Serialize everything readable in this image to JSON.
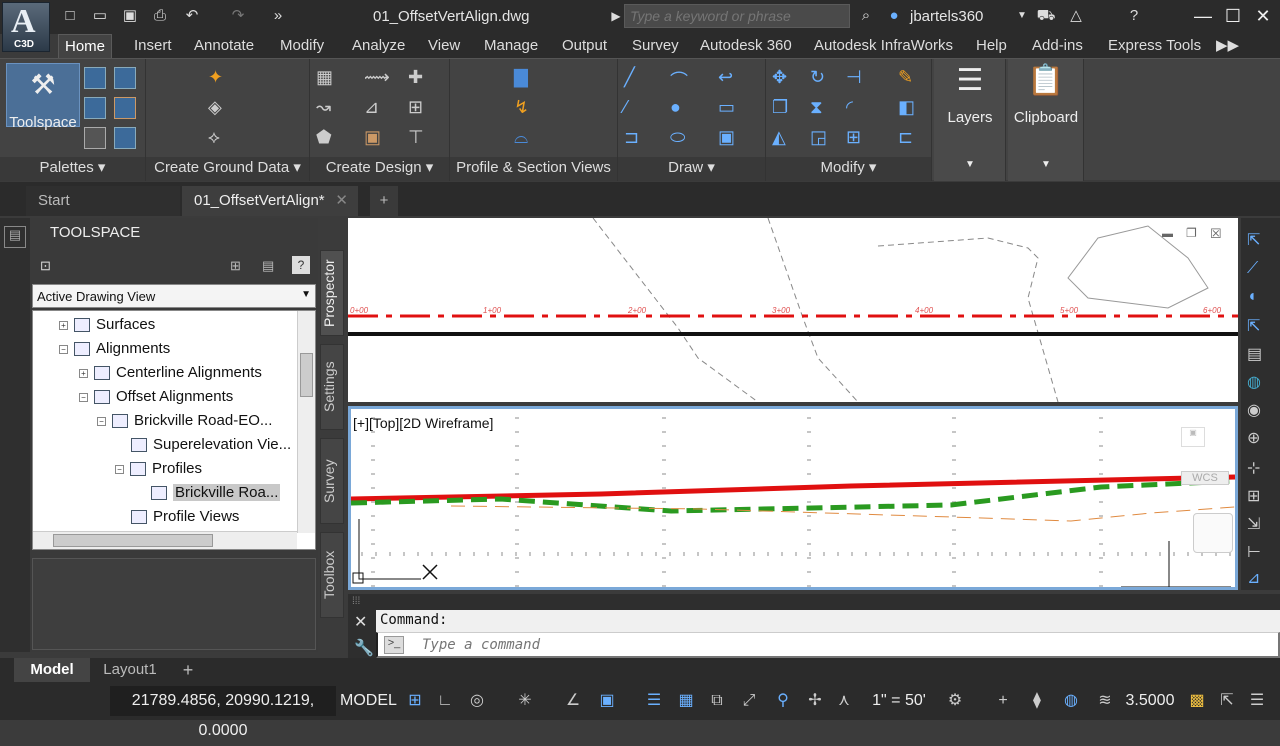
{
  "app": {
    "logo_text": "A",
    "logo_sub": "C3D",
    "doc_title": "01_OffsetVertAlign.dwg"
  },
  "search": {
    "placeholder": "Type a keyword or phrase"
  },
  "user": {
    "name": "jbartels360"
  },
  "menu_tabs": [
    "Home",
    "Insert",
    "Annotate",
    "Modify",
    "Analyze",
    "View",
    "Manage",
    "Output",
    "Survey",
    "Autodesk 360",
    "Autodesk InfraWorks",
    "Help",
    "Add-ins",
    "Express Tools"
  ],
  "ribbon": {
    "toolspace_label": "Toolspace",
    "layers_label": "Layers",
    "clipboard_label": "Clipboard",
    "panels": [
      "Palettes",
      "Create Ground Data",
      "Create Design",
      "Profile & Section Views",
      "Draw",
      "Modify"
    ]
  },
  "doc_tabs": {
    "start": "Start",
    "active": "01_OffsetVertAlign*"
  },
  "toolspace": {
    "title": "TOOLSPACE",
    "view_select": "Active Drawing View",
    "tree": [
      "Surfaces",
      "Alignments",
      "Centerline Alignments",
      "Offset Alignments",
      "Brickville Road-EO...",
      "Superelevation Vie...",
      "Profiles",
      "Brickville Roa...",
      "Profile Views"
    ],
    "side_tabs": [
      "Prospector",
      "Settings",
      "Survey",
      "Toolbox"
    ]
  },
  "viewport_top": {
    "stations": [
      "0+00",
      "1+00",
      "2+00",
      "3+00",
      "4+00",
      "5+00",
      "6+00"
    ]
  },
  "viewport_bottom": {
    "label": "[+][Top][2D Wireframe]",
    "wcs": "WCS"
  },
  "command": {
    "history": "Command:",
    "placeholder": "Type a command"
  },
  "layout_tabs": [
    "Model",
    "Layout1"
  ],
  "status": {
    "coords": "21789.4856, 20990.1219, 0.0000",
    "space": "MODEL",
    "scale": "1\" = 50'",
    "value": "3.5000"
  },
  "colors": {
    "accent": "#4a8ad8",
    "alignment_red": "#e01010",
    "profile_green": "#2a9a20"
  }
}
